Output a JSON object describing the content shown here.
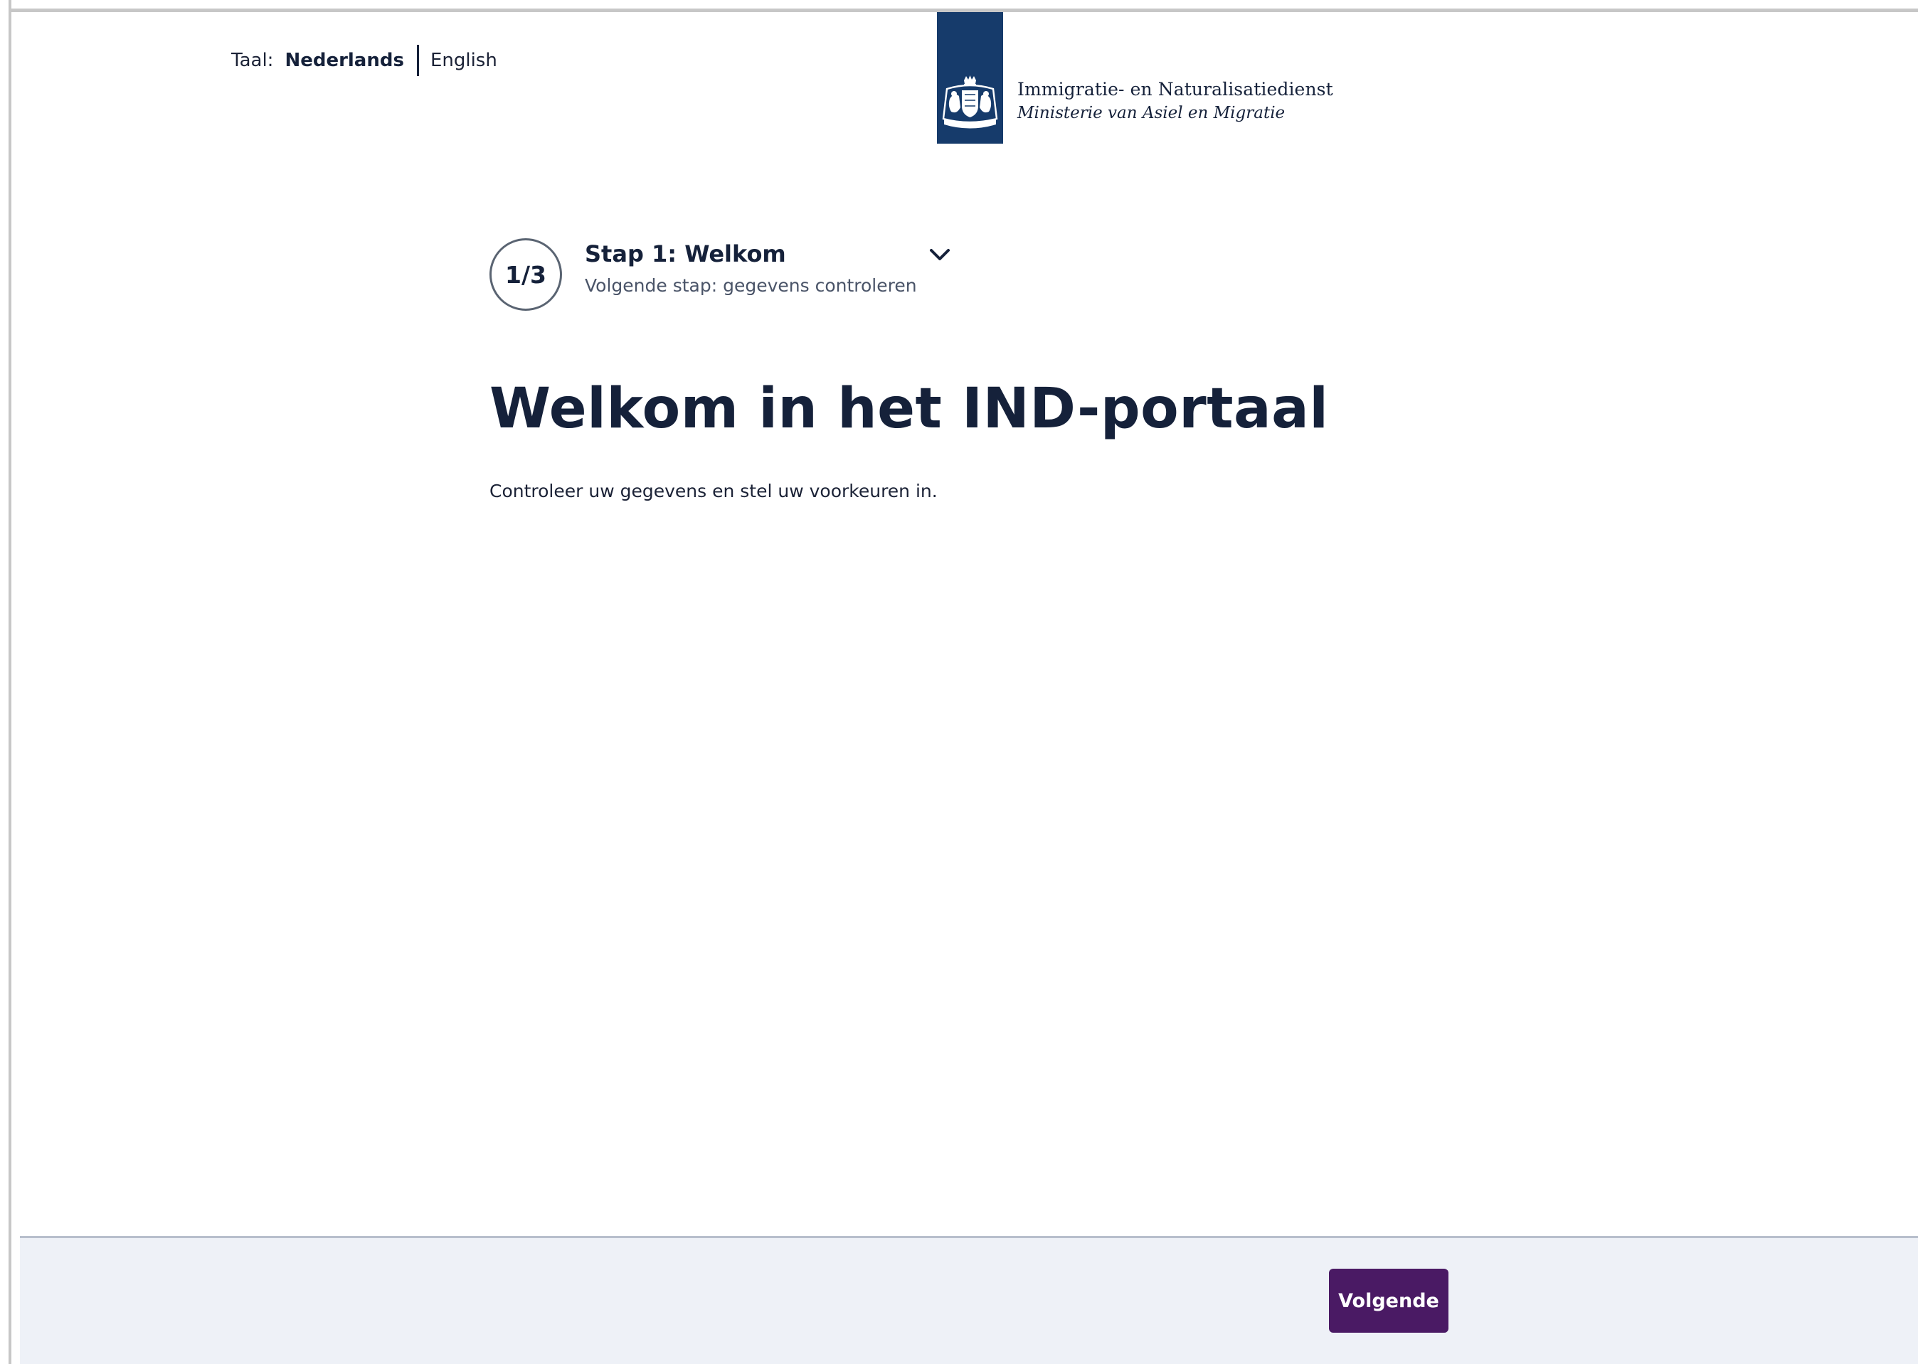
{
  "language": {
    "label": "Taal:",
    "active": "Nederlands",
    "other": "English"
  },
  "logo": {
    "organization": "Immigratie- en Naturalisatiedienst",
    "ministry": "Ministerie van Asiel en Migratie",
    "bar_color": "#163b6b"
  },
  "stepper": {
    "progress": "1/3",
    "current_step": 1,
    "total_steps": 3,
    "title": "Stap 1: Welkom",
    "next_step": "Volgende stap: gegevens controleren",
    "toggle_icon": "chevron-down-icon"
  },
  "main": {
    "title": "Welkom in het IND-portaal",
    "intro": "Controleer uw gegevens en stel uw voorkeuren in."
  },
  "footer": {
    "next_label": "Volgende",
    "button_color": "#4a1a64",
    "background_color": "#eef1f7"
  }
}
